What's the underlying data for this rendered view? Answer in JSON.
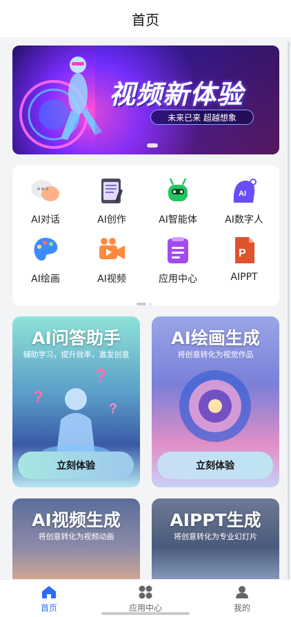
{
  "navbar": {
    "title": "首页"
  },
  "banner": {
    "title": "视频新体验",
    "subtitle": "未来已来 超越想象"
  },
  "grid": {
    "items": [
      {
        "label": "AI对话",
        "icon": "chat-bubbles-icon"
      },
      {
        "label": "AI创作",
        "icon": "clipboard-pen-icon"
      },
      {
        "label": "AI智能体",
        "icon": "robot-icon"
      },
      {
        "label": "AI数字人",
        "icon": "ai-head-icon"
      },
      {
        "label": "AI绘画",
        "icon": "palette-icon"
      },
      {
        "label": "AI视频",
        "icon": "video-camera-icon"
      },
      {
        "label": "应用中心",
        "icon": "app-document-icon"
      },
      {
        "label": "AIPPT",
        "icon": "ppt-file-icon"
      }
    ]
  },
  "features": [
    {
      "title": "AI问答助手",
      "subtitle": "辅助学习，提升效率，激发创意",
      "button": "立刻体验"
    },
    {
      "title": "AI绘画生成",
      "subtitle": "将创意转化为视觉作品",
      "button": "立刻体验"
    },
    {
      "title": "AI视频生成",
      "subtitle": "将创意转化为视频动画"
    },
    {
      "title": "AIPPT生成",
      "subtitle": "将创意转化为专业幻灯片"
    }
  ],
  "tabbar": {
    "items": [
      {
        "label": "首页",
        "icon": "home-icon",
        "active": true
      },
      {
        "label": "应用中心",
        "icon": "grid-apps-icon",
        "active": false
      },
      {
        "label": "我的",
        "icon": "user-icon",
        "active": false
      }
    ]
  },
  "colors": {
    "accent": "#2a6df4"
  }
}
